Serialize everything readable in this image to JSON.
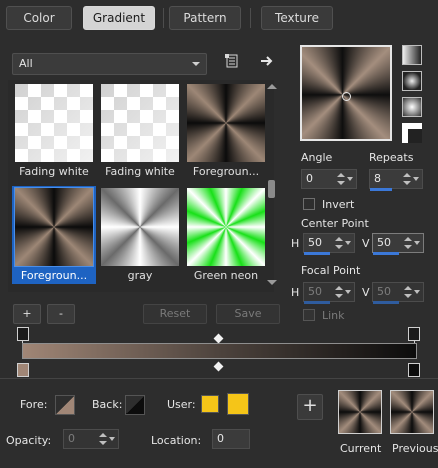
{
  "tabs": [
    {
      "label": "Color"
    },
    {
      "label": "Gradient",
      "active": true
    },
    {
      "label": "Pattern"
    },
    {
      "label": "Texture"
    }
  ],
  "filter": {
    "value": "All"
  },
  "gallery": {
    "items": [
      {
        "name": "Fading white",
        "swatch": "fading-white"
      },
      {
        "name": "Fading white",
        "swatch": "fading-white"
      },
      {
        "name": "Foregroun...",
        "swatch": "foreground"
      },
      {
        "name": "Foregroun...",
        "swatch": "foreground",
        "selected": true
      },
      {
        "name": "gray",
        "swatch": "gray"
      },
      {
        "name": "Green neon",
        "swatch": "green-neon"
      }
    ]
  },
  "buttons": {
    "add": "+",
    "remove": "-",
    "reset": "Reset",
    "save": "Save"
  },
  "angle": {
    "label": "Angle",
    "value": "0"
  },
  "repeats": {
    "label": "Repeats",
    "value": "8",
    "fill_fraction": 0.5
  },
  "invert": {
    "label": "Invert",
    "checked": false
  },
  "center_point": {
    "label": "Center Point",
    "h_label": "H",
    "h_value": "50",
    "v_label": "V",
    "v_value": "50"
  },
  "focal_point": {
    "label": "Focal Point",
    "h_label": "H",
    "h_value": "50",
    "v_label": "V",
    "v_value": "50"
  },
  "link": {
    "label": "Link",
    "checked": false
  },
  "bottom": {
    "fore_label": "Fore:",
    "back_label": "Back:",
    "user_label": "User:",
    "opacity_label": "Opacity:",
    "opacity_value": "0",
    "location_label": "Location:",
    "location_value": "0",
    "current_label": "Current",
    "previous_label": "Previous",
    "add_icon": "+"
  },
  "colors": {
    "accent": "#3b78d8",
    "selection": "#1e63c2",
    "gradient_start": "#a08676",
    "gradient_end": "#0c0c0c",
    "user_color": "#f5c518"
  }
}
